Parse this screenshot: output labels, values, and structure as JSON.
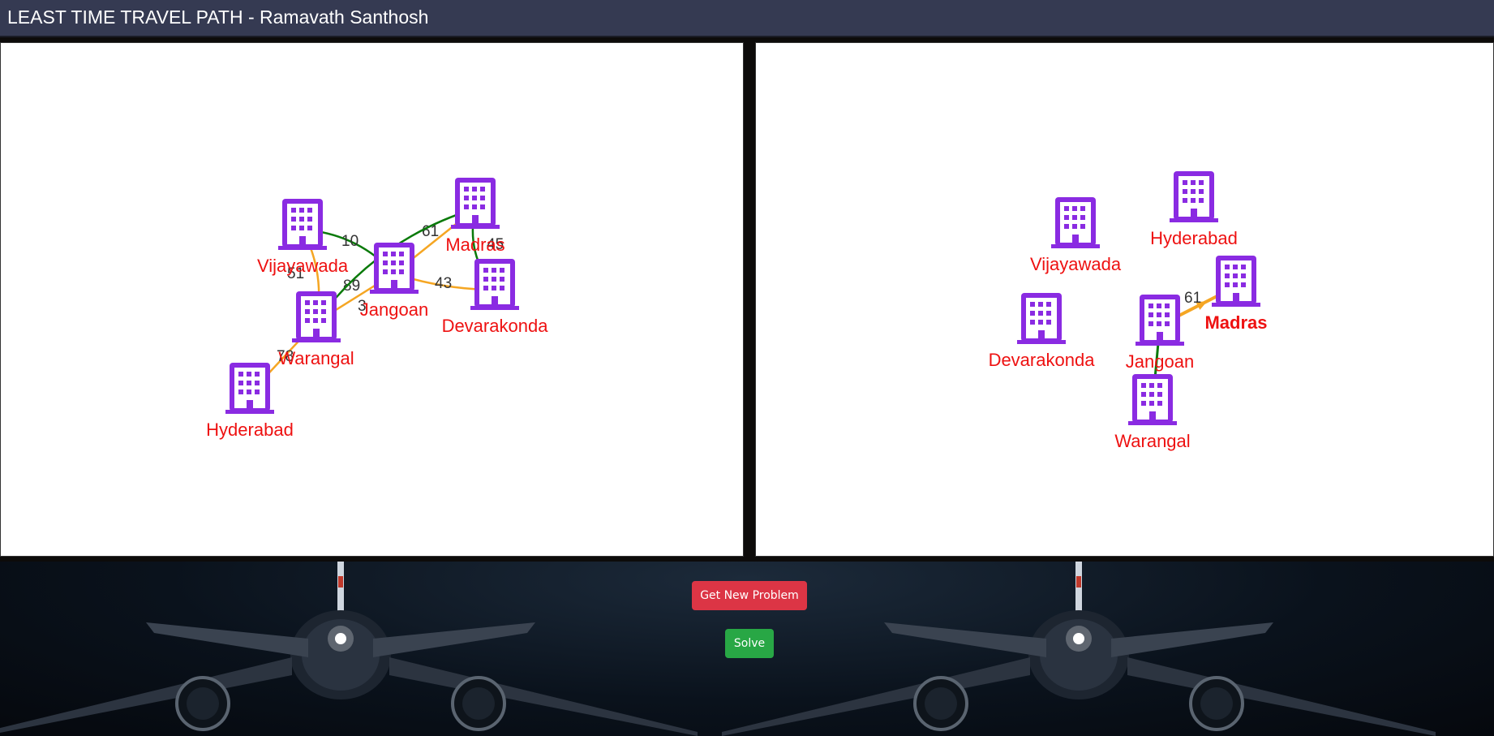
{
  "header": {
    "title": "LEAST TIME TRAVEL PATH - Ramavath Santhosh"
  },
  "colors": {
    "node_icon": "#8a2be2",
    "node_label": "#ee1111",
    "edge_orange": "#f5a623",
    "edge_green": "#0a7a0a",
    "btn_new": "#dc3545",
    "btn_solve": "#28a745"
  },
  "problem_graph": {
    "nodes": [
      {
        "id": "vij",
        "label": "Vijayawada"
      },
      {
        "id": "jan",
        "label": "Jangoan"
      },
      {
        "id": "mad",
        "label": "Madras"
      },
      {
        "id": "dev",
        "label": "Devarakonda"
      },
      {
        "id": "war",
        "label": "Warangal"
      },
      {
        "id": "hyd",
        "label": "Hyderabad"
      }
    ],
    "edges": [
      {
        "from": "vij",
        "to": "jan",
        "weight": "10",
        "color": "green"
      },
      {
        "from": "vij",
        "to": "war",
        "weight": "51",
        "color": "orange"
      },
      {
        "from": "jan",
        "to": "mad",
        "weight": "61",
        "color": "orange"
      },
      {
        "from": "jan",
        "to": "dev",
        "weight": "43",
        "color": "orange"
      },
      {
        "from": "war",
        "to": "jan",
        "weight": "89",
        "color": "orange"
      },
      {
        "from": "war",
        "to": "mad",
        "weight": "3",
        "color": "green"
      },
      {
        "from": "mad",
        "to": "dev",
        "weight": "45",
        "color": "green"
      },
      {
        "from": "hyd",
        "to": "war",
        "weight": "78",
        "color": "orange"
      }
    ]
  },
  "solution_graph": {
    "nodes": [
      {
        "id": "hyd",
        "label": "Hyderabad",
        "bold": false
      },
      {
        "id": "vij",
        "label": "Vijayawada",
        "bold": false
      },
      {
        "id": "mad",
        "label": "Madras",
        "bold": true
      },
      {
        "id": "dev",
        "label": "Devarakonda",
        "bold": false
      },
      {
        "id": "jan",
        "label": "Jangoan",
        "bold": false
      },
      {
        "id": "war",
        "label": "Warangal",
        "bold": false
      }
    ],
    "edges": [
      {
        "from": "war",
        "to": "jan",
        "weight": "",
        "color": "green"
      },
      {
        "from": "jan",
        "to": "mad",
        "weight": "61",
        "color": "orange"
      }
    ]
  },
  "buttons": {
    "new_problem": "Get New Problem",
    "solve": "Solve"
  },
  "background": {
    "image": "airplane-at-night"
  }
}
